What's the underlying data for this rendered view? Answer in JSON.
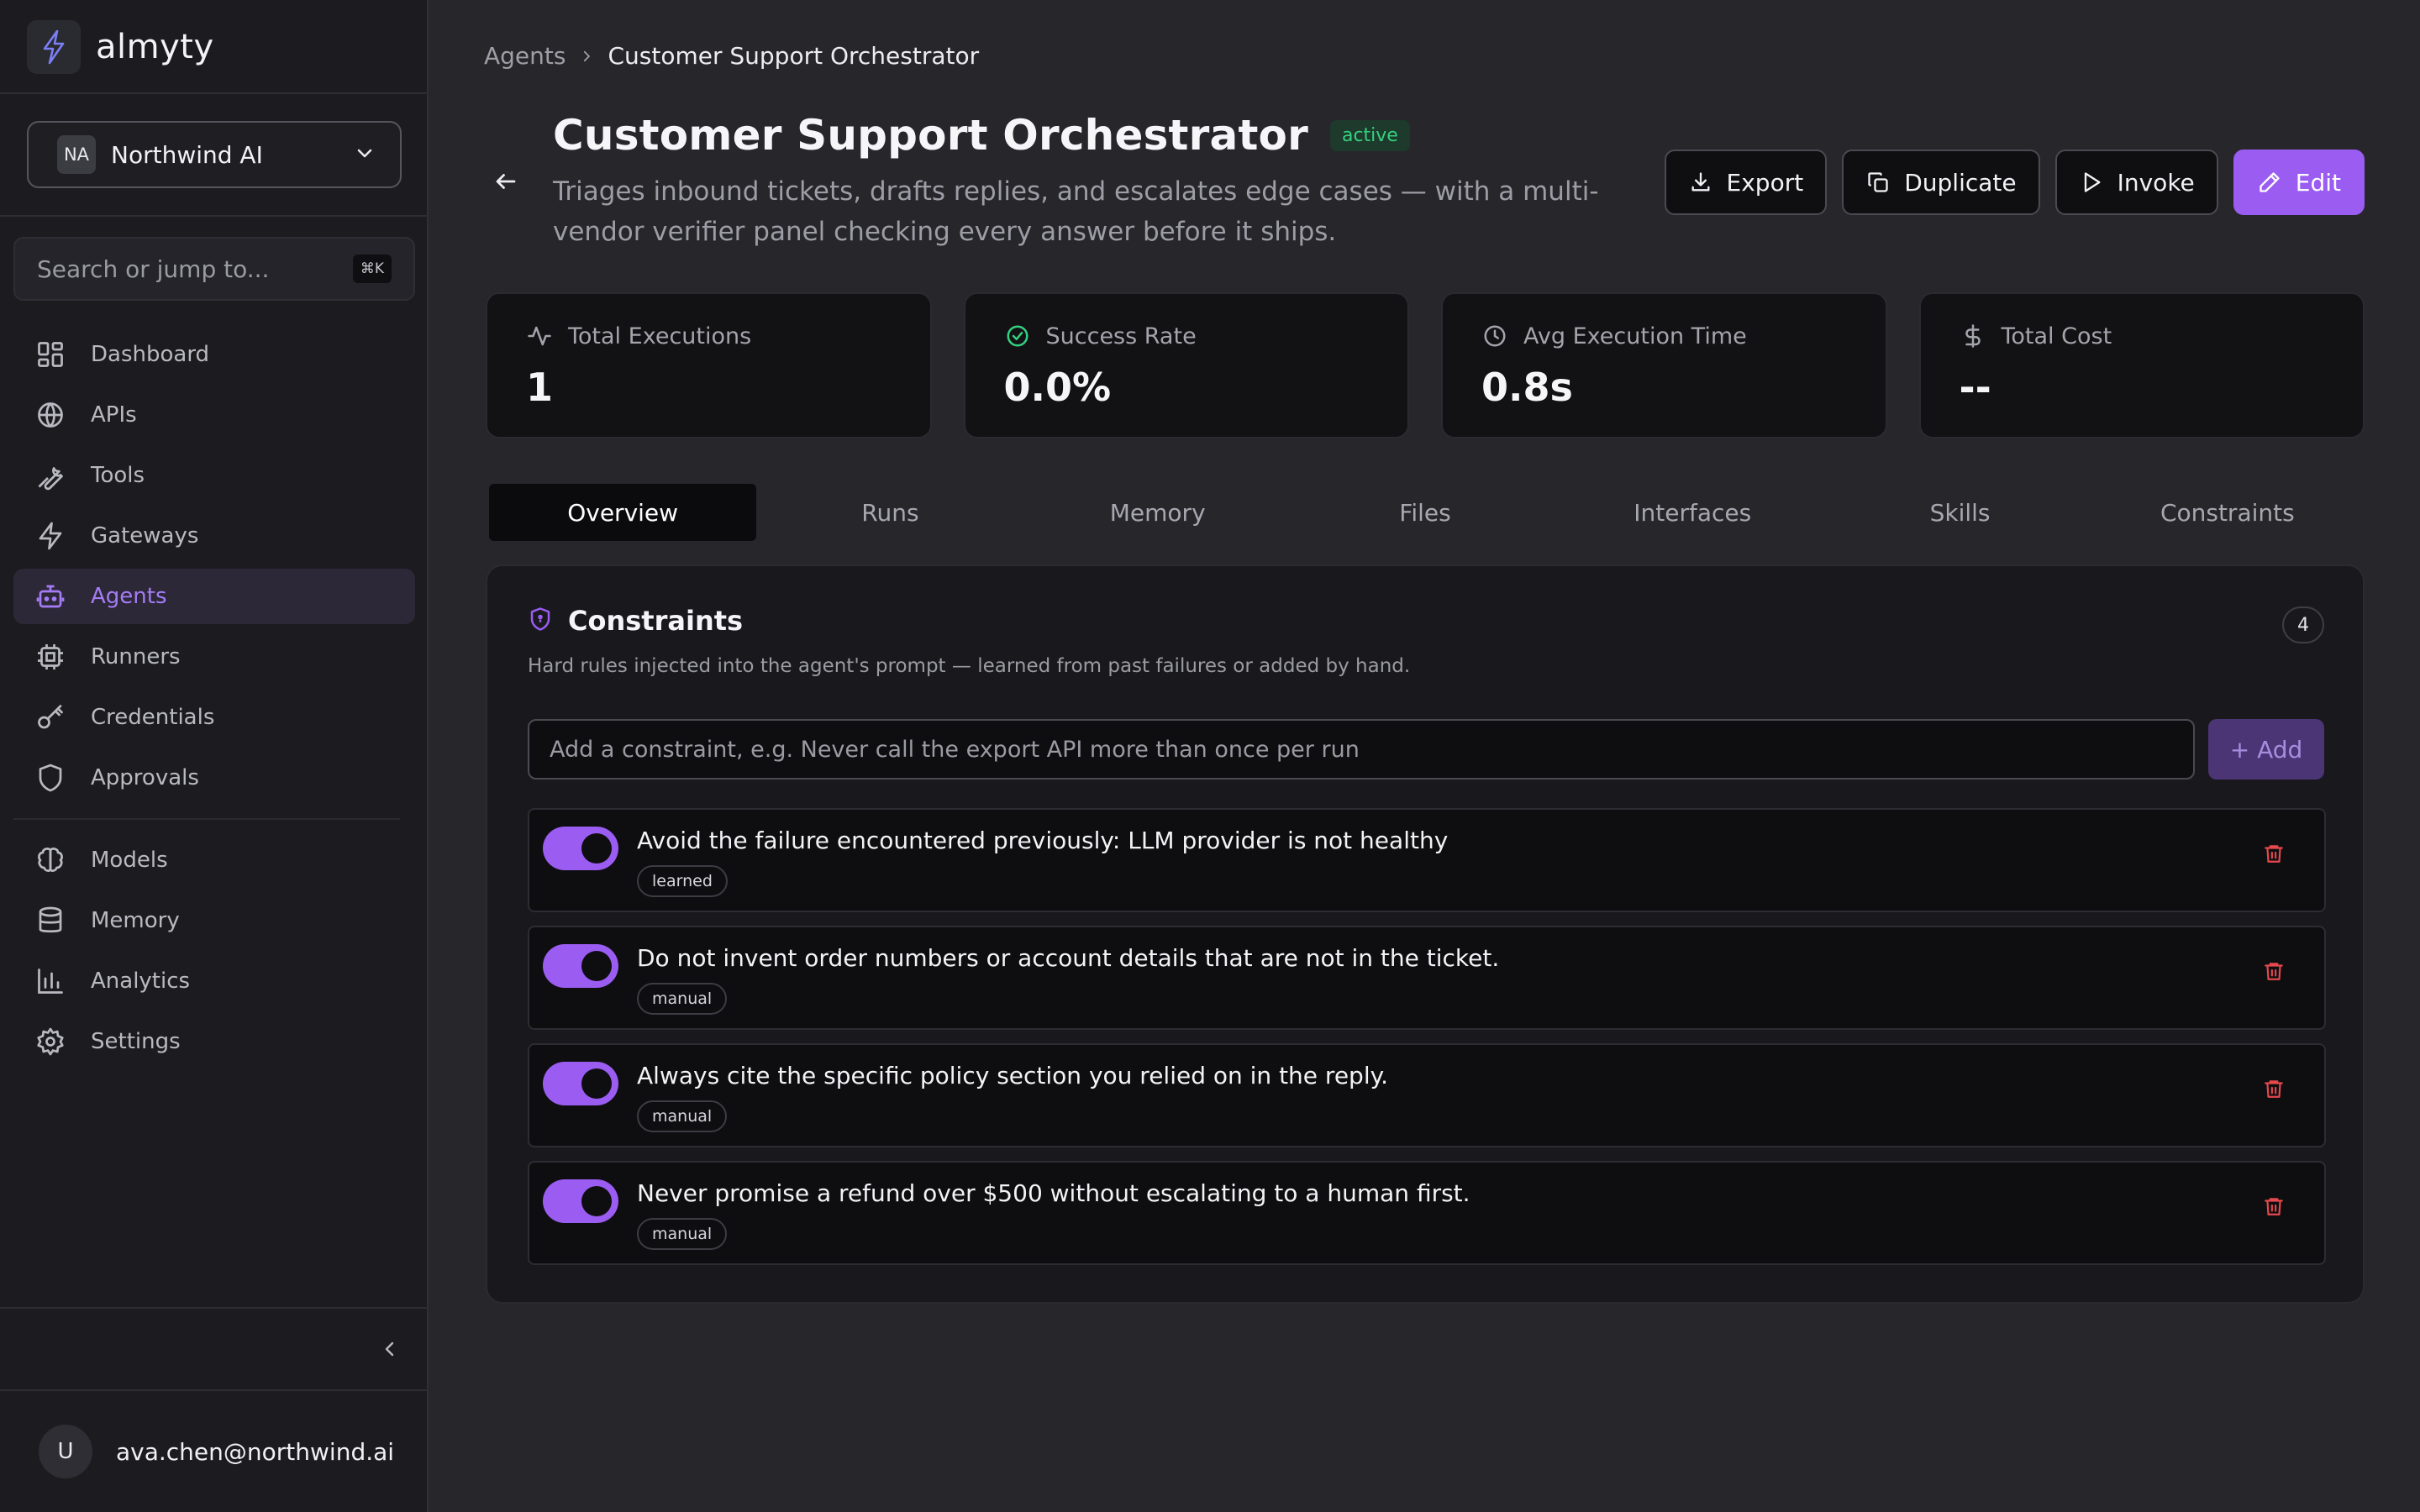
{
  "brand": {
    "name": "almyty"
  },
  "org": {
    "initials": "NA",
    "name": "Northwind AI"
  },
  "search": {
    "placeholder": "Search or jump to...",
    "shortcut": "⌘K"
  },
  "nav": {
    "primary": [
      {
        "label": "Dashboard",
        "icon": "grid-icon"
      },
      {
        "label": "APIs",
        "icon": "globe-icon"
      },
      {
        "label": "Tools",
        "icon": "wrench-icon"
      },
      {
        "label": "Gateways",
        "icon": "bolt-icon"
      },
      {
        "label": "Agents",
        "icon": "bot-icon",
        "active": true
      },
      {
        "label": "Runners",
        "icon": "chip-icon"
      },
      {
        "label": "Credentials",
        "icon": "key-icon"
      },
      {
        "label": "Approvals",
        "icon": "shield-icon"
      }
    ],
    "secondary": [
      {
        "label": "Models",
        "icon": "brain-icon"
      },
      {
        "label": "Memory",
        "icon": "database-icon"
      },
      {
        "label": "Analytics",
        "icon": "bar-chart-icon"
      },
      {
        "label": "Settings",
        "icon": "gear-icon"
      }
    ]
  },
  "user": {
    "initial": "U",
    "email": "ava.chen@northwind.ai"
  },
  "breadcrumb": {
    "parent": "Agents",
    "current": "Customer Support Orchestrator"
  },
  "agent": {
    "title": "Customer Support Orchestrator",
    "status": "active",
    "description": "Triages inbound tickets, drafts replies, and escalates edge cases — with a multi-vendor verifier panel checking every answer before it ships."
  },
  "actions": {
    "export": "Export",
    "duplicate": "Duplicate",
    "invoke": "Invoke",
    "edit": "Edit"
  },
  "stats": [
    {
      "label": "Total Executions",
      "value": "1",
      "icon": "activity-icon"
    },
    {
      "label": "Success Rate",
      "value": "0.0%",
      "icon": "check-circle-icon"
    },
    {
      "label": "Avg Execution Time",
      "value": "0.8s",
      "icon": "clock-icon"
    },
    {
      "label": "Total Cost",
      "value": "--",
      "icon": "dollar-icon"
    }
  ],
  "tabs": [
    "Overview",
    "Runs",
    "Memory",
    "Files",
    "Interfaces",
    "Skills",
    "Constraints"
  ],
  "active_tab": "Overview",
  "constraints": {
    "title": "Constraints",
    "count": "4",
    "subtitle": "Hard rules injected into the agent's prompt — learned from past failures or added by hand.",
    "input_placeholder": "Add a constraint, e.g. Never call the export API more than once per run",
    "add_label": "+ Add",
    "items": [
      {
        "text": "Avoid the failure encountered previously: LLM provider is not healthy",
        "tag": "learned",
        "enabled": true
      },
      {
        "text": "Do not invent order numbers or account details that are not in the ticket.",
        "tag": "manual",
        "enabled": true
      },
      {
        "text": "Always cite the specific policy section you relied on in the reply.",
        "tag": "manual",
        "enabled": true
      },
      {
        "text": "Never promise a refund over $500 without escalating to a human first.",
        "tag": "manual",
        "enabled": true
      }
    ]
  },
  "colors": {
    "accent": "#9a5cf1",
    "accent_text": "#a57cf5",
    "success": "#34d17f",
    "danger": "#e5484d",
    "background": "#27262b",
    "sidebar": "#1c1c20"
  }
}
